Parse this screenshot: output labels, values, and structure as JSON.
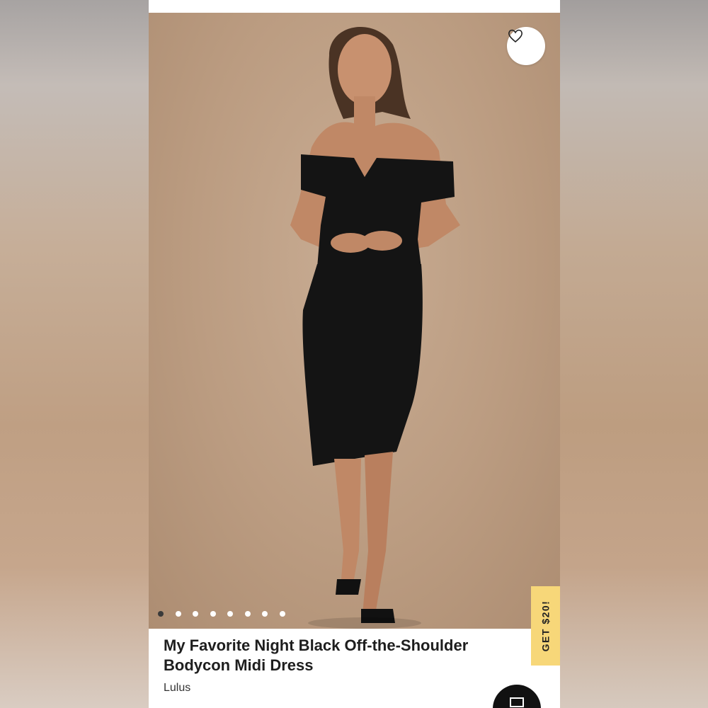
{
  "product": {
    "title": "My Favorite Night Black Off-the-Shoulder Bodycon Midi Dress",
    "brand": "Lulus"
  },
  "gallery": {
    "image_count": 8,
    "active_index": 0
  },
  "promo": {
    "label": "GET $20!"
  },
  "icons": {
    "favorite": "heart-icon",
    "chat": "chat-icon"
  },
  "colors": {
    "promo_bg": "#f7d779",
    "image_bg": "#c4a58a",
    "fab_bg": "#111111"
  }
}
